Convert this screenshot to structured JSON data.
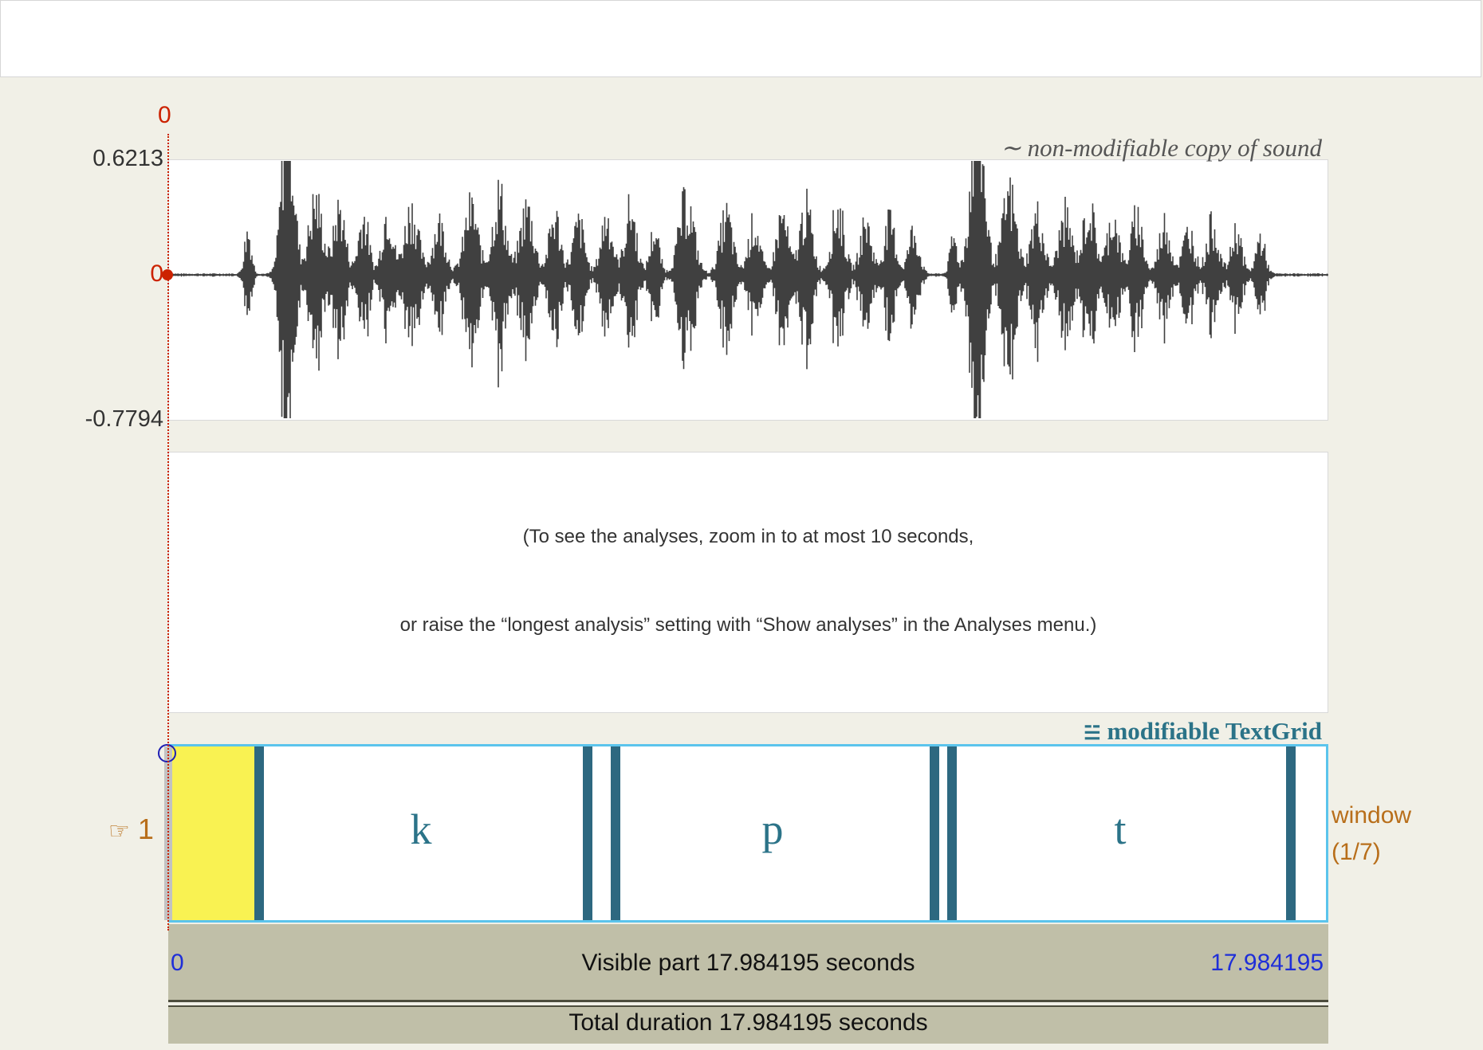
{
  "waveform": {
    "max_label": "0.6213",
    "zero_label": "0",
    "min_label": "-0.7794",
    "cursor_label": "0",
    "title": "non-modifiable copy of sound",
    "title_icon": "tilde-icon"
  },
  "analysis": {
    "message_line1": "(To see the analyses, zoom in to at most 10 seconds,",
    "message_line2": "or raise the “longest analysis” setting with “Show analyses” in the Analyses menu.)"
  },
  "textgrid": {
    "title": "modifiable TextGrid",
    "title_icon": "textgrid-lines-icon",
    "tier_number": "1",
    "tier_pointer_icon": "pointing-hand-icon",
    "tier_name_line1": "window",
    "tier_name_line2": "(1/7)",
    "interval_labels": [
      "k",
      "p",
      "t"
    ]
  },
  "time_axis": {
    "visible_start": "0",
    "visible_label": "Visible part 17.984195 seconds",
    "visible_end": "17.984195",
    "total_label": "Total duration 17.984195 seconds"
  },
  "colors": {
    "waveform": "#404040",
    "cursor": "#cc2200",
    "tier_border": "#5bc4ec",
    "selection": "#f9f252",
    "boundary": "#2d6880",
    "label": "#2b7388"
  }
}
